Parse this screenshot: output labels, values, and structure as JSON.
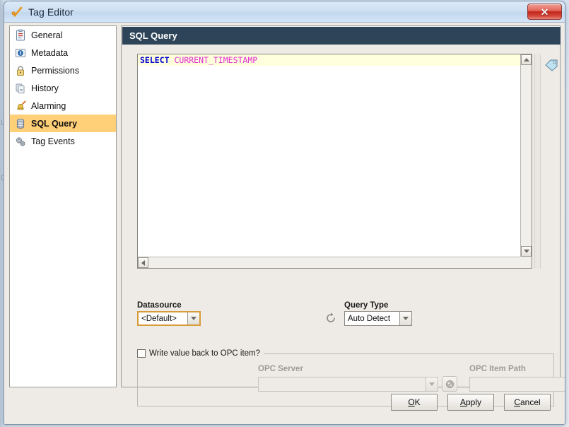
{
  "window": {
    "title": "Tag Editor",
    "title_icon": "tag-check-icon",
    "close_label": "✕"
  },
  "sidebar": {
    "items": [
      {
        "label": "General",
        "icon": "clipboard-icon",
        "selected": false
      },
      {
        "label": "Metadata",
        "icon": "info-icon",
        "selected": false
      },
      {
        "label": "Permissions",
        "icon": "lock-icon",
        "selected": false
      },
      {
        "label": "History",
        "icon": "history-icon",
        "selected": false
      },
      {
        "label": "Alarming",
        "icon": "bell-icon",
        "selected": false
      },
      {
        "label": "SQL Query",
        "icon": "database-icon",
        "selected": true
      },
      {
        "label": "Tag Events",
        "icon": "gears-icon",
        "selected": false
      }
    ],
    "selected_color": "#ffd077"
  },
  "content": {
    "section_title": "SQL Query",
    "header_color": "#2d4459",
    "editor": {
      "code_segments": [
        {
          "text": "SELECT",
          "kind": "keyword",
          "color": "#0000d0"
        },
        {
          "text": " ",
          "kind": "plain",
          "color": "#000000"
        },
        {
          "text": "CURRENT_TIMESTAMP",
          "kind": "function",
          "color": "#e02ad0"
        }
      ],
      "full_text": "SELECT CURRENT_TIMESTAMP",
      "current_line_highlight": "#ffffdd",
      "tag_button_icon": "tag-icon"
    },
    "datasource": {
      "label": "Datasource",
      "value": "<Default>",
      "focused": true,
      "refresh_icon": "refresh-icon"
    },
    "query_type": {
      "label": "Query Type",
      "value": "Auto Detect"
    },
    "opc": {
      "checkbox_label": "Write value back to OPC item?",
      "checked": false,
      "enabled": false,
      "server_label": "OPC Server",
      "server_value": "",
      "server_placeholder": "",
      "browse_icon": "browse-icon",
      "item_path_label": "OPC Item Path",
      "item_path_value": "",
      "item_path_placeholder": "",
      "add_icon": "plus-icon"
    }
  },
  "footer": {
    "ok": {
      "pre": "",
      "mnemonic": "O",
      "post": "K"
    },
    "apply": {
      "pre": "",
      "mnemonic": "A",
      "post": "pply"
    },
    "cancel": {
      "pre": "",
      "mnemonic": "C",
      "post": "ancel"
    }
  }
}
